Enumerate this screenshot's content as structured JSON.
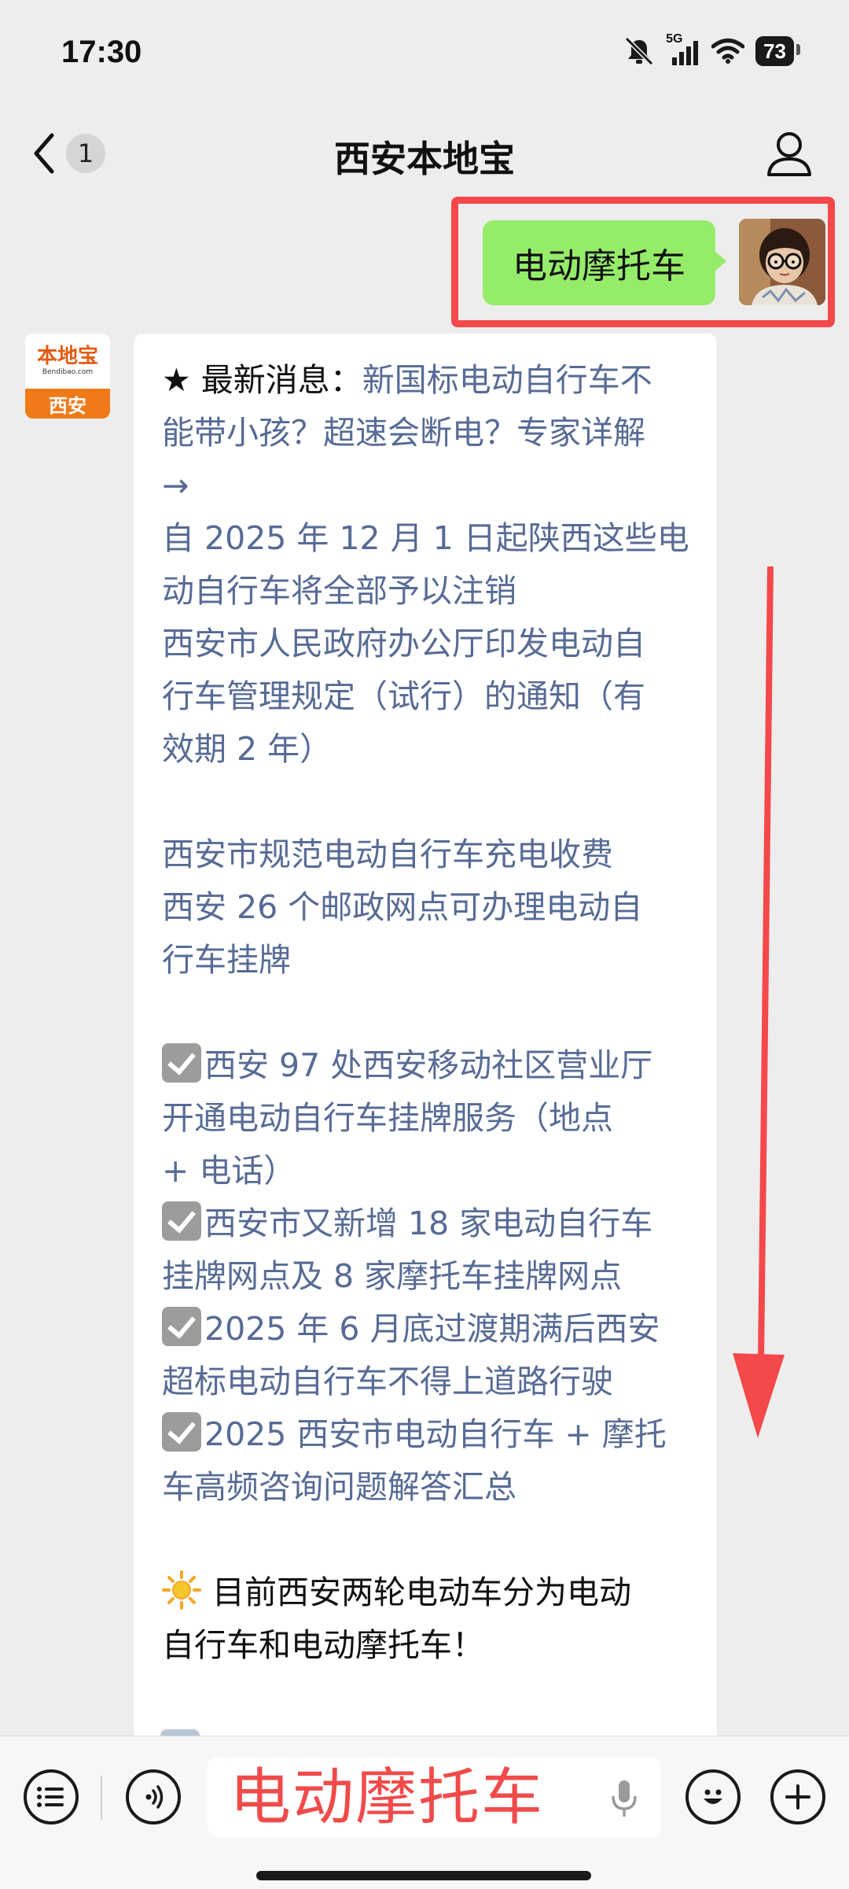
{
  "status_bar": {
    "time": "17:30",
    "network": "5G",
    "battery": "73"
  },
  "nav": {
    "unread_count": "1",
    "title": "西安本地宝"
  },
  "chat": {
    "user_message": "电动摩托车",
    "bot_avatar": {
      "logo_text": "本地宝",
      "logo_url": "Bendibao.com",
      "city": "西安"
    },
    "reply": {
      "line_1_prefix": "★ 最新消息：",
      "line_1_link": "新国标电动自行车不",
      "line_2": "能带小孩？超速会断电？专家详解",
      "line_3": "→",
      "line_4": "自 2025 年 12 月 1 日起陕西这些电",
      "line_5": "动自行车将全部予以注销",
      "line_6": "西安市人民政府办公厅印发电动自",
      "line_7": "行车管理规定（试行）的通知（有",
      "line_8": "效期 2 年）",
      "line_9": "西安市规范电动自行车充电收费",
      "line_10": "西安 26 个邮政网点可办理电动自",
      "line_11": "行车挂牌",
      "line_12": "西安 97 处西安移动社区营业厅",
      "line_13": "开通电动自行车挂牌服务（地点",
      "line_14": "+ 电话）",
      "line_15": "西安市又新增 18 家电动自行车",
      "line_16": "挂牌网点及 8 家摩托车挂牌网点",
      "line_17": "2025 年 6 月底过渡期满后西安",
      "line_18": "超标电动自行车不得上道路行驶",
      "line_19": "2025 西安市电动自行车 + 摩托",
      "line_20": "车高频咨询问题解答汇总",
      "line_21": "目前西安两轮电动车分为电动",
      "line_22": "自行车和电动摩托车！"
    }
  },
  "input": {
    "value": "电动摩托车"
  },
  "colors": {
    "link": "#576b95",
    "bubble_green": "#95ec69",
    "annotation_red": "#f4484b",
    "input_text": "#f14a4a"
  },
  "icons": [
    "back-icon",
    "profile-icon",
    "menu-list-icon",
    "voice-icon",
    "mic-icon",
    "emoji-icon",
    "plus-icon",
    "check-icon",
    "sun-icon"
  ]
}
